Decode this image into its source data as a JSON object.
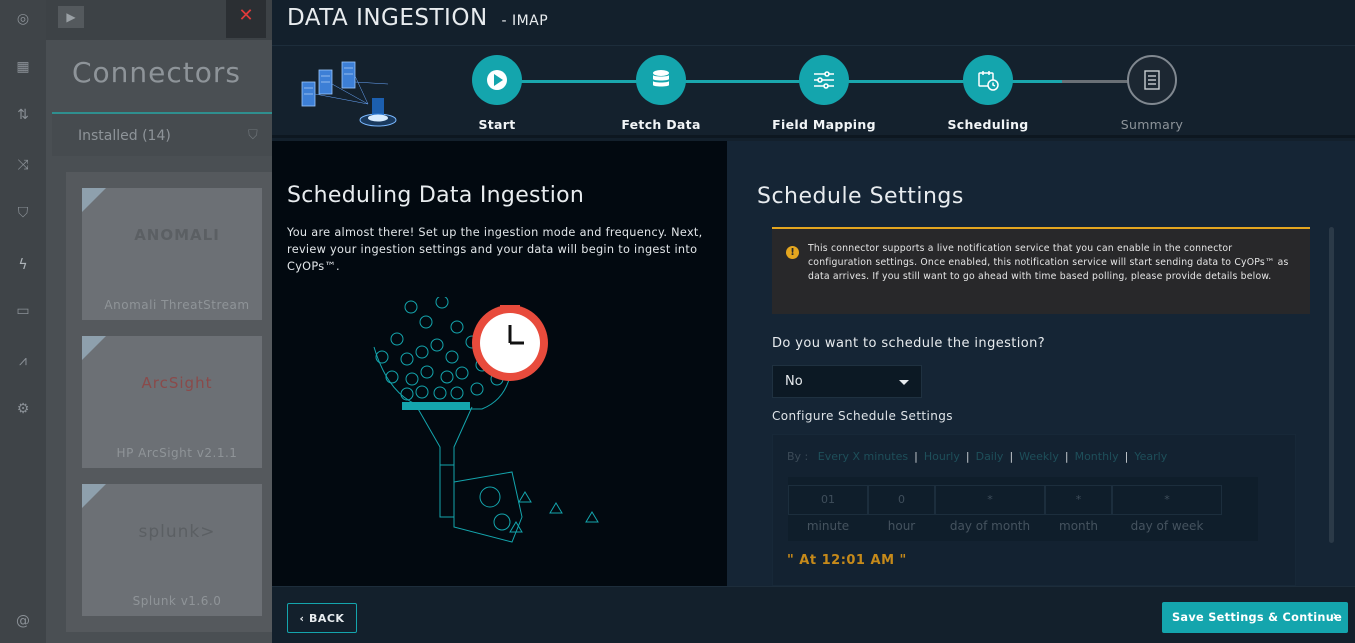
{
  "background_app": {
    "title": "Connectors",
    "tab_installed": "Installed (14)",
    "cards": [
      {
        "logo": "ANOMALI",
        "name": "Anomali ThreatStream"
      },
      {
        "logo": "ArcSight",
        "name": "HP ArcSight v2.1.1"
      },
      {
        "logo": "splunk>",
        "name": "Splunk v1.6.0"
      }
    ]
  },
  "modal": {
    "title": "DATA INGESTION",
    "subtitle": "- IMAP",
    "steps": [
      {
        "label": "Start",
        "state": "done"
      },
      {
        "label": "Fetch Data",
        "state": "done"
      },
      {
        "label": "Field Mapping",
        "state": "done"
      },
      {
        "label": "Scheduling",
        "state": "active"
      },
      {
        "label": "Summary",
        "state": "pending"
      }
    ],
    "left": {
      "heading": "Scheduling Data Ingestion",
      "description": "You are almost there! Set up the ingestion mode and frequency. Next, review your ingestion settings and your data will begin to ingest into CyOPs™."
    },
    "right": {
      "heading": "Schedule Settings",
      "notice": "This connector supports a live notification service that you can enable in the connector configuration settings. Once enabled, this notification service will start sending data to CyOPs™ as data arrives. If you still want to go ahead with time based polling, please provide details below.",
      "question": "Do you want to schedule the ingestion?",
      "schedule_select_value": "No",
      "configure_label": "Configure Schedule Settings",
      "by_label": "By :",
      "by_options": [
        "Every X minutes",
        "Hourly",
        "Daily",
        "Weekly",
        "Monthly",
        "Yearly"
      ],
      "cron": {
        "values": [
          "01",
          "0",
          "*",
          "*",
          "*"
        ],
        "captions": [
          "minute",
          "hour",
          "day of month",
          "month",
          "day of week"
        ]
      },
      "at_text": "\" At 12:01 AM \""
    },
    "footer": {
      "back_label": "BACK",
      "save_label": "Save Settings & Continue"
    }
  },
  "colors": {
    "accent": "#14a5ad",
    "warning": "#e4a61f",
    "at_text": "#c68a1a",
    "close": "#e03a3a"
  }
}
